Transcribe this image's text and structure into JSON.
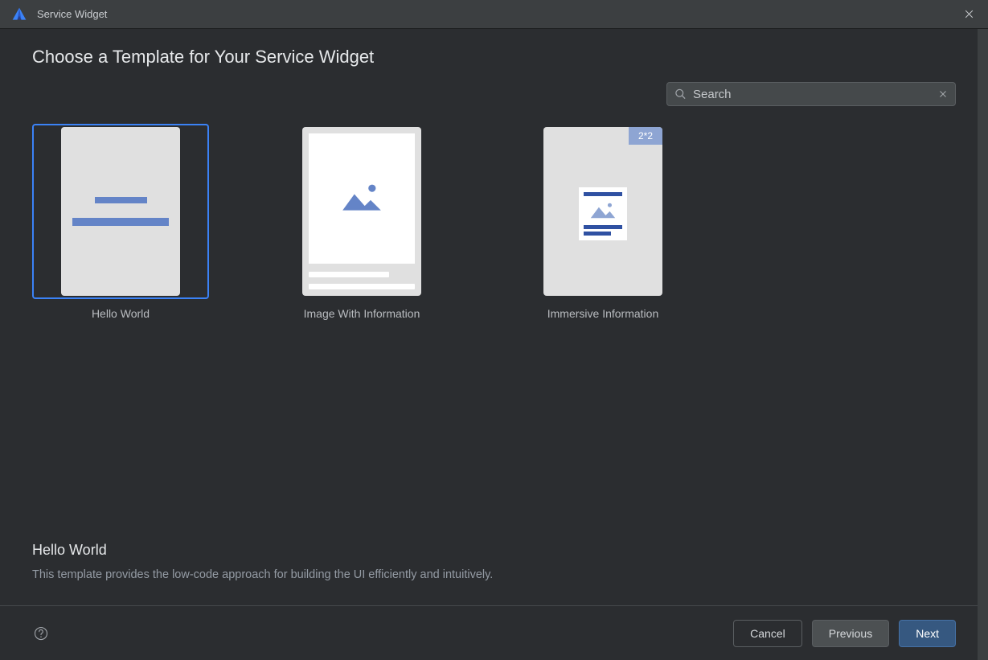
{
  "window": {
    "title": "Service Widget"
  },
  "page": {
    "heading": "Choose a Template for Your Service Widget"
  },
  "search": {
    "placeholder": "Search",
    "value": ""
  },
  "templates": [
    {
      "label": "Hello World",
      "selected": true
    },
    {
      "label": "Image With Information",
      "selected": false
    },
    {
      "label": "Immersive Information",
      "selected": false,
      "badge": "2*2"
    }
  ],
  "description": {
    "title": "Hello World",
    "text": "This template provides the low-code approach for building the UI efficiently and intuitively."
  },
  "footer": {
    "cancel": "Cancel",
    "previous": "Previous",
    "next": "Next"
  }
}
